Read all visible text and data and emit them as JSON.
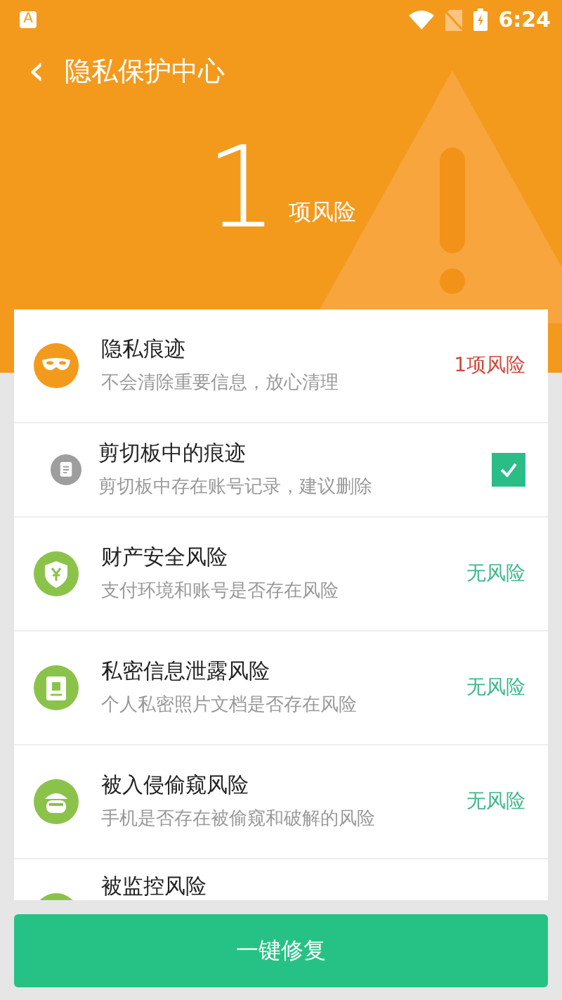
{
  "status_bar": {
    "app_icon": "A",
    "time": "6:24"
  },
  "header": {
    "back": "‹",
    "title": "隐私保护中心",
    "count": "1",
    "count_label": "项风险"
  },
  "items": [
    {
      "kind": "main",
      "title": "隐私痕迹",
      "subtitle": "不会清除重要信息，放心清理",
      "at_risk": true,
      "result": "1项风险"
    },
    {
      "kind": "sub",
      "title": "剪切板中的痕迹",
      "subtitle": "剪切板中存在账号记录，建议删除",
      "checked": true
    },
    {
      "kind": "main",
      "title": "财产安全风险",
      "subtitle": "支付环境和账号是否存在风险",
      "at_risk": false,
      "result": "无风险"
    },
    {
      "kind": "main",
      "title": "私密信息泄露风险",
      "subtitle": "个人私密照片文档是否存在风险",
      "at_risk": false,
      "result": "无风险"
    },
    {
      "kind": "main",
      "title": "被入侵偷窥风险",
      "subtitle": "手机是否存在被偷窥和破解的风险",
      "at_risk": false,
      "result": "无风险"
    },
    {
      "kind": "cut",
      "title": "被监控风险"
    }
  ],
  "button": "一键修复"
}
